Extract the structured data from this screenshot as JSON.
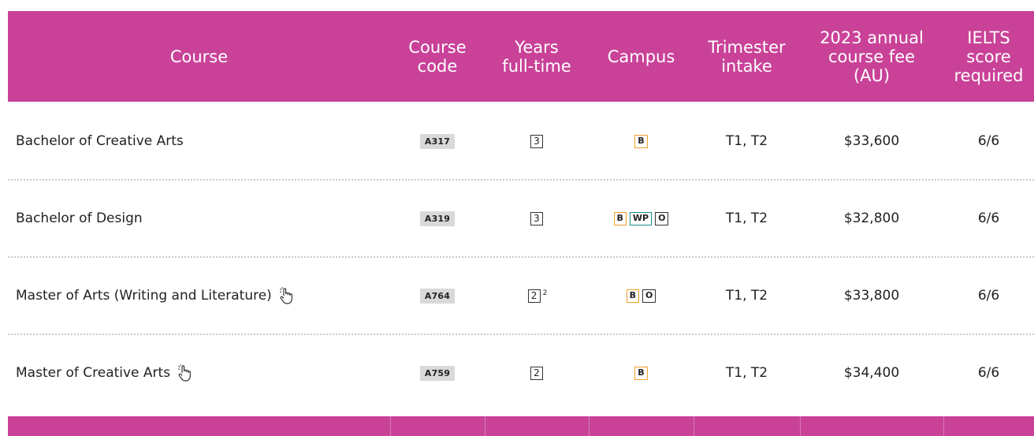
{
  "header": {
    "course": "Course",
    "course_code": "Course\ncode",
    "years": "Years\nfull-time",
    "campus": "Campus",
    "intake": "Trimester\nintake",
    "fee": "2023 annual\ncourse fee\n(AU)",
    "ielts": "IELTS\nscore\nrequired"
  },
  "rows": [
    {
      "course": "Bachelor of Creative Arts",
      "code": "A317",
      "years": "3",
      "footnote": "",
      "campus": [
        "B"
      ],
      "intake": "T1, T2",
      "fee": "$33,600",
      "ielts": "6/6",
      "icon": ""
    },
    {
      "course": "Bachelor of Design",
      "code": "A319",
      "years": "3",
      "footnote": "",
      "campus": [
        "B",
        "WP",
        "O"
      ],
      "intake": "T1, T2",
      "fee": "$32,800",
      "ielts": "6/6",
      "icon": ""
    },
    {
      "course": "Master of Arts (Writing and Literature)",
      "code": "A764",
      "years": "2",
      "footnote": "2",
      "campus": [
        "B",
        "O"
      ],
      "intake": "T1, T2",
      "fee": "$33,800",
      "ielts": "6/6",
      "icon": "hand-pointer-icon"
    },
    {
      "course": "Master of Creative Arts",
      "code": "A759",
      "years": "2",
      "footnote": "",
      "campus": [
        "B"
      ],
      "intake": "T1, T2",
      "fee": "$34,400",
      "ielts": "6/6",
      "icon": "hand-pointer-icon"
    }
  ],
  "colors": {
    "header_bg": "#c94298",
    "campus_b": "#f0a028",
    "campus_wp": "#1b8c8c",
    "campus_o": "#333333"
  }
}
